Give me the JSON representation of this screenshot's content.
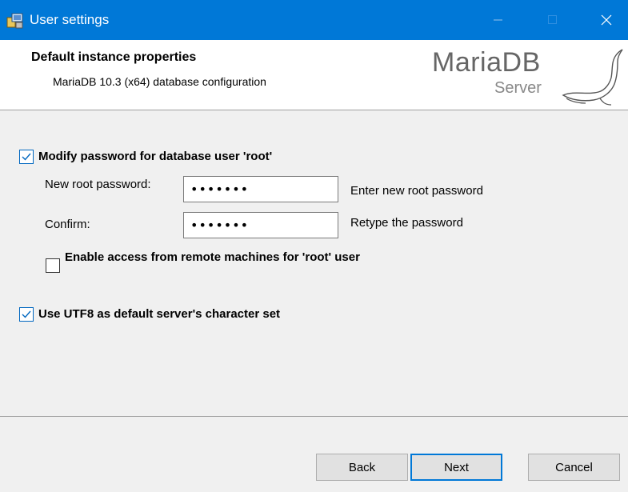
{
  "window": {
    "title": "User settings"
  },
  "header": {
    "title": "Default instance properties",
    "subtitle": "MariaDB 10.3 (x64) database configuration",
    "logo": {
      "wordmark": "MariaDB",
      "sub": "Server"
    }
  },
  "form": {
    "modify_password": {
      "label": "Modify password for database user 'root'",
      "checked": true
    },
    "new_password": {
      "label": "New root password:",
      "value": "•••••••",
      "hint": "Enter new root password"
    },
    "confirm": {
      "label": "Confirm:",
      "value": "•••••••",
      "hint": "Retype the password"
    },
    "remote_access": {
      "label": "Enable access from remote machines for 'root' user",
      "checked": false
    },
    "utf8": {
      "label": "Use UTF8 as default server's character set",
      "checked": true
    }
  },
  "buttons": {
    "back": "Back",
    "next": "Next",
    "cancel": "Cancel"
  },
  "colors": {
    "titlebar": "#0078d7",
    "accent": "#0078d7",
    "panel": "#f0f0f0"
  }
}
